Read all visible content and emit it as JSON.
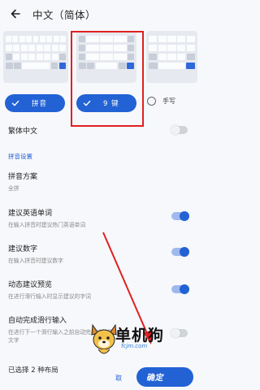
{
  "header": {
    "back_icon": "arrow-left-icon",
    "title": "中文（简体）"
  },
  "layouts": {
    "options": [
      {
        "label": "拼音",
        "selected": true
      },
      {
        "label": "9 键",
        "selected": true
      },
      {
        "label": "手写",
        "selected": false
      }
    ]
  },
  "settings": {
    "traditional": {
      "label": "繁体中文",
      "enabled": false
    },
    "section_title": "拼音设置",
    "scheme": {
      "label": "拼音方案",
      "value": "全拼"
    },
    "english_suggest": {
      "label": "建议英语单词",
      "desc": "在输入拼音时建议热门英语单词",
      "enabled": true
    },
    "number_suggest": {
      "label": "建议数字",
      "desc": "在输入拼音时建议数字",
      "enabled": true
    },
    "dynamic_preview": {
      "label": "动态建议预览",
      "desc": "在进行滑行输入时显示建议的字词",
      "enabled": true
    },
    "auto_glide": {
      "label": "自动完成滑行输入",
      "desc_line1": "在进行下一个滑行输入之前自动完成当前所",
      "desc_line2": "文字",
      "enabled": false
    }
  },
  "footer": {
    "status": "已选择 2 种布局"
  },
  "watermark": {
    "title": "单机狗",
    "url": "fcjm.com",
    "cancel_label": "取",
    "pill_text": "确定"
  },
  "colors": {
    "accent": "#2262d4",
    "highlight_box": "#e02020",
    "background": "#f7f8fb"
  }
}
